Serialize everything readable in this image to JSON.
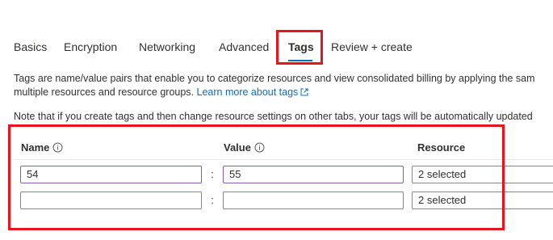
{
  "tabs": [
    {
      "label": "Basics"
    },
    {
      "label": "Encryption"
    },
    {
      "label": "Networking"
    },
    {
      "label": "Advanced"
    },
    {
      "label": "Tags"
    },
    {
      "label": "Review + create"
    }
  ],
  "active_tab": "Tags",
  "description": {
    "line1": "Tags are name/value pairs that enable you to categorize resources and view consolidated billing by applying the sam",
    "line2_prefix": "multiple resources and resource groups.",
    "learn_more": "Learn more about tags",
    "note": "Note that if you create tags and then change resource settings on other tabs, your tags will be automatically updated"
  },
  "table": {
    "headers": {
      "name": "Name",
      "value": "Value",
      "resource": "Resource"
    },
    "separator": ":",
    "rows": [
      {
        "name": "54",
        "value": "55",
        "resource": "2 selected"
      },
      {
        "name": "",
        "value": "",
        "resource": "2 selected"
      }
    ]
  },
  "colors": {
    "accent": "#0f6cbd",
    "highlight": "#e8141c",
    "focus": "#8a5bb4"
  }
}
